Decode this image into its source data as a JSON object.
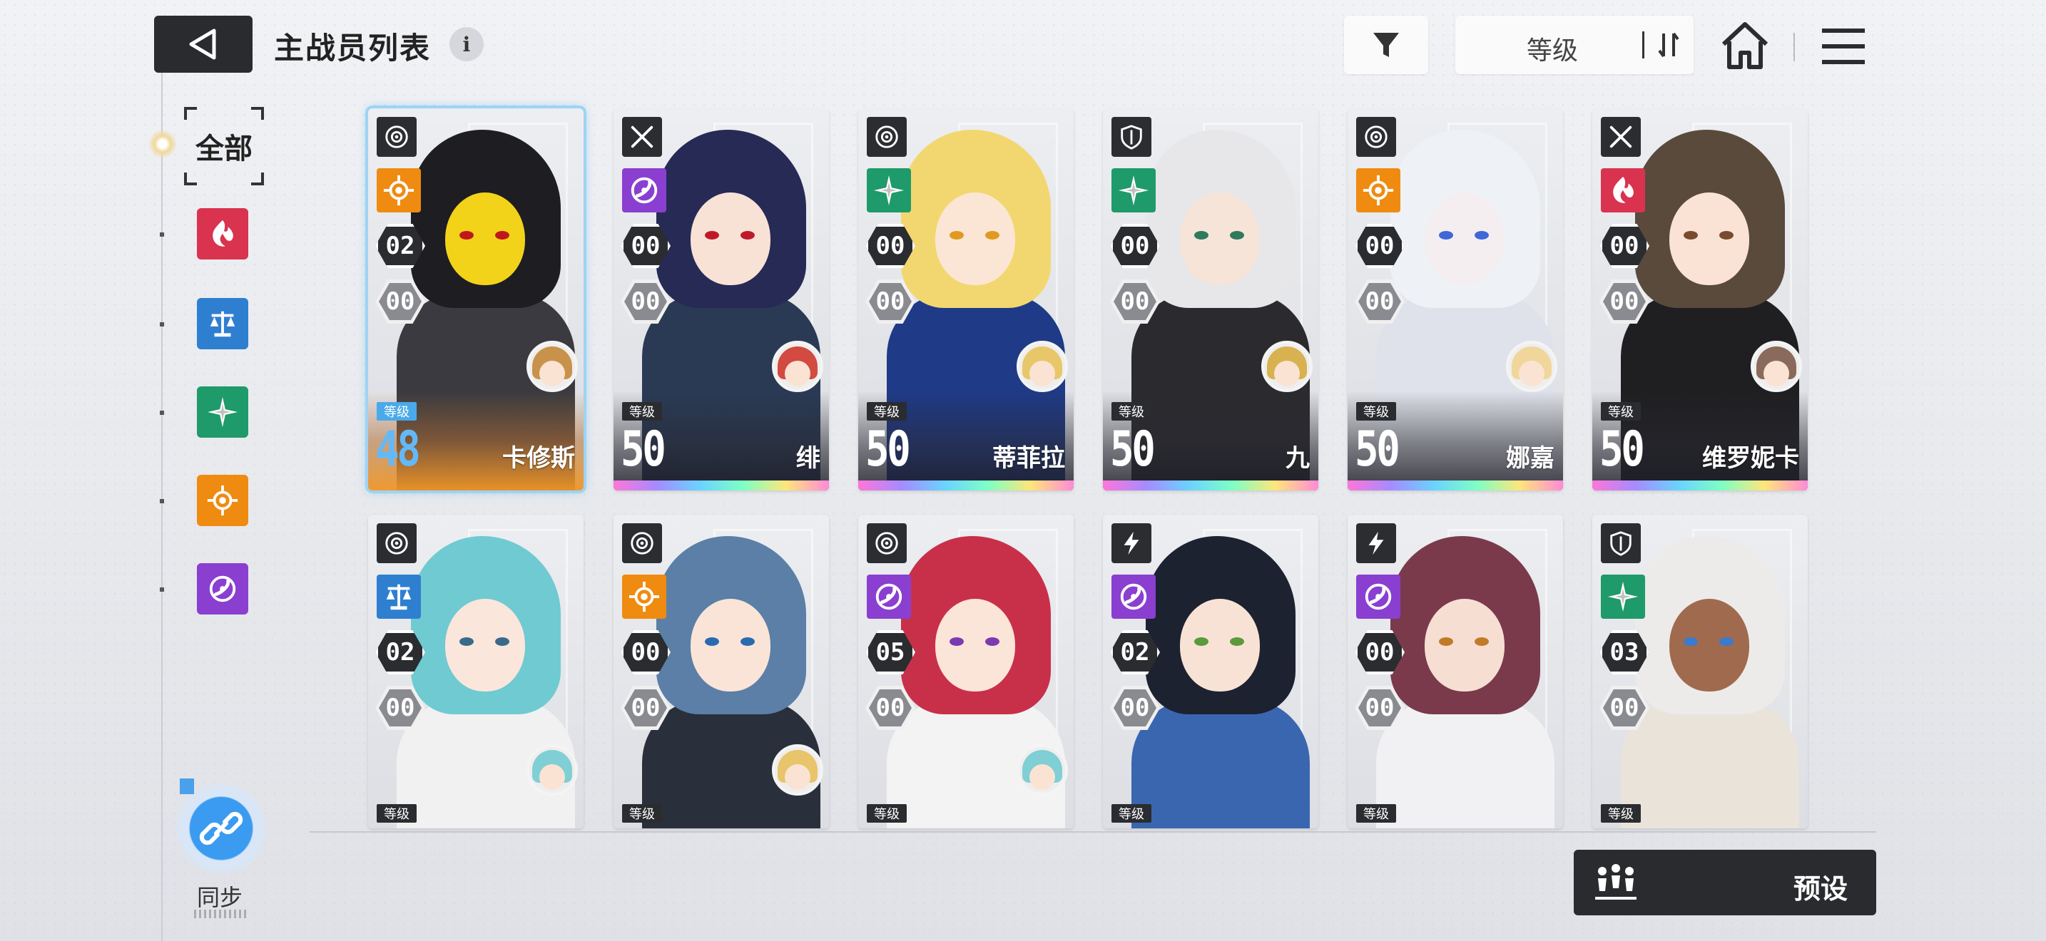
{
  "header": {
    "title": "主战员列表",
    "info_glyph": "i",
    "sort_label": "等级"
  },
  "sidebar": {
    "all_label": "全部",
    "filters": [
      {
        "id": "burst",
        "color": "#d93350",
        "icon": "flame-spiral-icon"
      },
      {
        "id": "balance",
        "color": "#2f7fd0",
        "icon": "scales-icon"
      },
      {
        "id": "wind",
        "color": "#1f9a6a",
        "icon": "compass-star-icon"
      },
      {
        "id": "sun",
        "color": "#ef8b10",
        "icon": "sun-crosshair-icon"
      },
      {
        "id": "void",
        "color": "#8a3fd0",
        "icon": "vortex-icon"
      }
    ]
  },
  "sync": {
    "label": "同步"
  },
  "preset": {
    "label": "预设"
  },
  "level_tag": "等级",
  "cards": [
    {
      "name": "卡修斯",
      "level": "48",
      "star": "02",
      "rank": "00",
      "class_icon": "target-icon",
      "element": "sun",
      "selected": true,
      "hair": "#1d1d22",
      "face": "#f2d31a",
      "eye": "#c0181a",
      "body": "#3a3a40",
      "sa_hair": "#c9924a"
    },
    {
      "name": "绯",
      "level": "50",
      "star": "00",
      "rank": "00",
      "class_icon": "crossed-swords-icon",
      "element": "void",
      "hair": "#262a55",
      "face": "#f8e2d6",
      "eye": "#c01a2a",
      "body": "#2a3a55",
      "sa_hair": "#d34a40"
    },
    {
      "name": "蒂菲拉",
      "level": "50",
      "star": "00",
      "rank": "00",
      "class_icon": "target-icon",
      "element": "wind",
      "hair": "#f2d770",
      "face": "#fbe6d6",
      "eye": "#e19a20",
      "body": "#1f3a86",
      "sa_hair": "#e8c76a"
    },
    {
      "name": "九",
      "level": "50",
      "star": "00",
      "rank": "00",
      "class_icon": "shield-icon",
      "element": "wind",
      "hair": "#e7e7ea",
      "face": "#f7e4d8",
      "eye": "#2e7a5c",
      "body": "#2b2b2f",
      "sa_hair": "#d8b250"
    },
    {
      "name": "娜嘉",
      "level": "50",
      "star": "00",
      "rank": "00",
      "class_icon": "target-icon",
      "element": "sun",
      "hair": "#eef1f6",
      "face": "#f4eef0",
      "eye": "#3e68d8",
      "body": "#dfe2ea",
      "sa_hair": "#f0d69a"
    },
    {
      "name": "维罗妮卡",
      "level": "50",
      "star": "00",
      "rank": "00",
      "class_icon": "crossed-swords-icon",
      "element": "burst",
      "hair": "#5a4a3c",
      "face": "#fae3d4",
      "eye": "#7a4a30",
      "body": "#1f1f22",
      "sa_hair": "#8a6a5a"
    },
    {
      "name": "",
      "level": "",
      "star": "02",
      "rank": "00",
      "class_icon": "target-icon",
      "element": "balance",
      "hair": "#6fcad2",
      "face": "#fbe6dc",
      "eye": "#3a6a8a",
      "body": "#f1f1f1",
      "sa_hair": "#7fcfd4"
    },
    {
      "name": "",
      "level": "",
      "star": "00",
      "rank": "00",
      "class_icon": "target-icon",
      "element": "sun",
      "hair": "#5b7fa6",
      "face": "#fae4d8",
      "eye": "#2a6ab0",
      "body": "#2a2f3c",
      "sa_hair": "#e8c46a"
    },
    {
      "name": "",
      "level": "",
      "star": "05",
      "rank": "00",
      "class_icon": "target-icon",
      "element": "void",
      "hair": "#c8304a",
      "face": "#fbe4d8",
      "eye": "#7a3ab0",
      "body": "#f3f3f3",
      "sa_hair": "#7fcfd4"
    },
    {
      "name": "",
      "level": "",
      "star": "02",
      "rank": "00",
      "class_icon": "lightning-icon",
      "element": "void",
      "hair": "#1c2230",
      "face": "#f8e2d6",
      "eye": "#5a9a3a",
      "body": "#3a66b0",
      "sa_hair": ""
    },
    {
      "name": "",
      "level": "",
      "star": "00",
      "rank": "00",
      "class_icon": "lightning-icon",
      "element": "void",
      "hair": "#7a3a4c",
      "face": "#f6dfd2",
      "eye": "#c07a2a",
      "body": "#f1f1f3",
      "sa_hair": ""
    },
    {
      "name": "",
      "level": "",
      "star": "03",
      "rank": "00",
      "class_icon": "shield-icon",
      "element": "wind",
      "hair": "#ecebea",
      "face": "#a06a4e",
      "eye": "#3a7ad0",
      "body": "#e9e3da",
      "sa_hair": ""
    }
  ]
}
